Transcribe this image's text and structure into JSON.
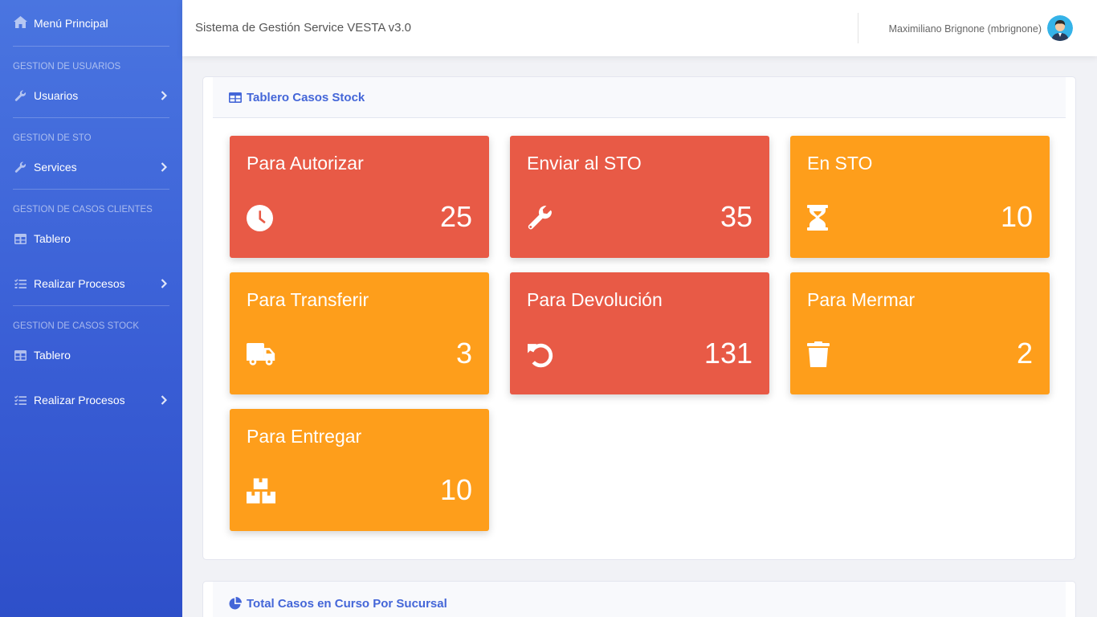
{
  "sidebar": {
    "brand": "Menú Principal",
    "sections": {
      "usuarios_heading": "GESTION DE USUARIOS",
      "sto_heading": "GESTION DE STO",
      "clientes_heading": "GESTION DE CASOS CLIENTES",
      "stock_heading": "GESTION DE CASOS STOCK"
    },
    "items": {
      "usuarios": "Usuarios",
      "services": "Services",
      "clientes_tablero": "Tablero",
      "clientes_procesos": "Realizar Procesos",
      "stock_tablero": "Tablero",
      "stock_procesos": "Realizar Procesos"
    }
  },
  "topbar": {
    "title": "Sistema de Gestión Service VESTA v3.0",
    "user": "Maximiliano Brignone (mbrignone)"
  },
  "main": {
    "card1_title": "Tablero Casos Stock",
    "card2_title": "Total Casos en Curso Por Sucursal",
    "tiles": [
      {
        "title": "Para Autorizar",
        "value": "25",
        "icon": "clock-icon",
        "color": "#e85a46"
      },
      {
        "title": "Enviar al STO",
        "value": "35",
        "icon": "wrench-icon",
        "color": "#e85a46"
      },
      {
        "title": "En STO",
        "value": "10",
        "icon": "hourglass-icon",
        "color": "#fe9e1b"
      },
      {
        "title": "Para Transferir",
        "value": "3",
        "icon": "truck-icon",
        "color": "#fe9e1b"
      },
      {
        "title": "Para Devolución",
        "value": "131",
        "icon": "undo-icon",
        "color": "#e85a46"
      },
      {
        "title": "Para Mermar",
        "value": "2",
        "icon": "trash-icon",
        "color": "#fe9e1b"
      },
      {
        "title": "Para Entregar",
        "value": "10",
        "icon": "boxes-icon",
        "color": "#fe9e1b"
      }
    ]
  },
  "colors": {
    "sidebar_top": "#4a75e0",
    "sidebar_bottom": "#2e4fc9",
    "accent": "#4466d8",
    "tile_red": "#e85a46",
    "tile_orange": "#fe9e1b"
  }
}
